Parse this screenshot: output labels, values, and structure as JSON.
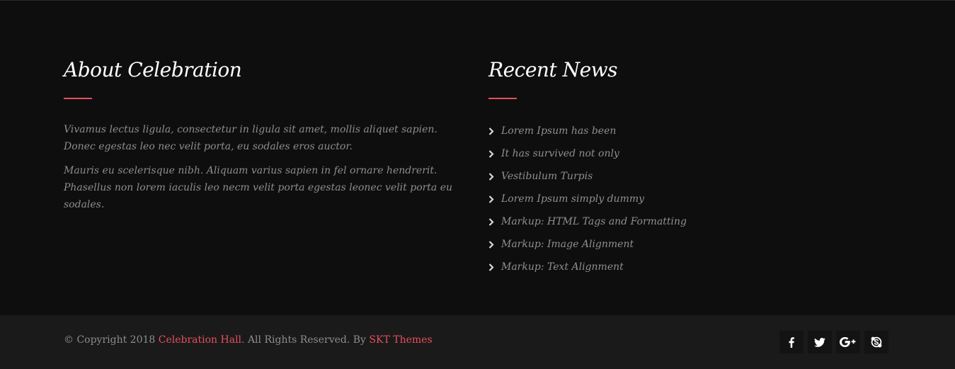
{
  "about": {
    "title": "About Celebration",
    "paragraphs": [
      "Vivamus lectus ligula, consectetur in ligula sit amet, mollis aliquet sapien. Donec egestas leo nec velit porta, eu sodales eros auctor.",
      "Mauris eu scelerisque nibh. Aliquam varius sapien in fel ornare hendrerit. Phasellus non lorem iaculis leo necm velit porta egestas leonec velit porta eu sodales."
    ]
  },
  "news": {
    "title": "Recent News",
    "items": [
      "Lorem Ipsum has been",
      "It has survived not only",
      "Vestibulum Turpis",
      "Lorem Ipsum simply dummy",
      "Markup: HTML Tags and Formatting",
      "Markup: Image Alignment",
      "Markup: Text Alignment"
    ]
  },
  "copyright": {
    "prefix": "© Copyright 2018 ",
    "site_link": "Celebration Hall.",
    "middle": " All Rights Reserved. By ",
    "theme_link": "SKT Themes"
  },
  "social": [
    "facebook-icon",
    "twitter-icon",
    "google-plus-icon",
    "skype-icon"
  ],
  "colors": {
    "accent": "#e5505a",
    "background": "#0e0e0f",
    "bottom_bar": "#1a1a1b"
  }
}
